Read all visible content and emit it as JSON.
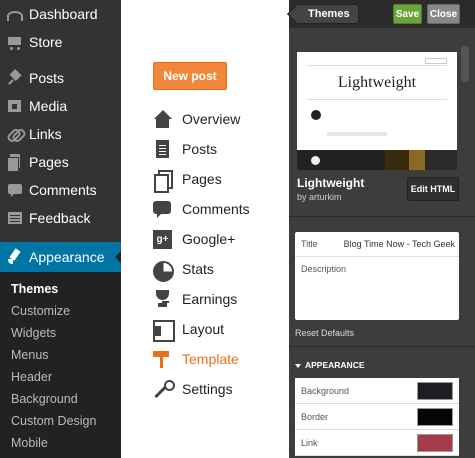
{
  "wp_menu": {
    "items": [
      {
        "label": "Dashboard",
        "icon": "dashboard-icon"
      },
      {
        "label": "Store",
        "icon": "cart-icon"
      },
      {
        "label": "Posts",
        "icon": "pin-icon"
      },
      {
        "label": "Media",
        "icon": "media-icon"
      },
      {
        "label": "Links",
        "icon": "link-icon"
      },
      {
        "label": "Pages",
        "icon": "pages-icon"
      },
      {
        "label": "Comments",
        "icon": "comment-icon"
      },
      {
        "label": "Feedback",
        "icon": "feedback-icon"
      }
    ],
    "active": {
      "label": "Appearance",
      "icon": "paintbrush-icon"
    },
    "submenu": [
      "Themes",
      "Customize",
      "Widgets",
      "Menus",
      "Header",
      "Background",
      "Custom Design",
      "Mobile"
    ],
    "colors": {
      "bg": "#333333",
      "active": "#0074a2",
      "submenu_bg": "#222222"
    }
  },
  "blogger_menu": {
    "new_post": "New post",
    "items": [
      {
        "label": "Overview",
        "icon": "home-icon"
      },
      {
        "label": "Posts",
        "icon": "document-icon"
      },
      {
        "label": "Pages",
        "icon": "pages-icon"
      },
      {
        "label": "Comments",
        "icon": "comment-icon"
      },
      {
        "label": "Google+",
        "icon": "google-plus-icon"
      },
      {
        "label": "Stats",
        "icon": "pie-chart-icon"
      },
      {
        "label": "Earnings",
        "icon": "trophy-icon"
      },
      {
        "label": "Layout",
        "icon": "layout-icon"
      },
      {
        "label": "Template",
        "icon": "paint-roller-icon"
      },
      {
        "label": "Settings",
        "icon": "wrench-icon"
      }
    ],
    "active_item": "Template",
    "colors": {
      "accent": "#e8701a",
      "button": "#f2863a"
    }
  },
  "customizer": {
    "back_label": "Themes",
    "save_label": "Save",
    "close_label": "Close",
    "preview_title": "Lightweight",
    "theme_name": "Lightweight",
    "theme_author": "by arturkim",
    "edit_html_label": "Edit HTML",
    "title_label": "Title",
    "title_value": "Blog Time Now - Tech Geek",
    "description_label": "Description",
    "reset_label": "Reset Defaults",
    "section_label": "APPEARANCE",
    "colors": [
      {
        "label": "Background",
        "value": "#1e1e22"
      },
      {
        "label": "Border",
        "value": "#050505"
      },
      {
        "label": "Link",
        "value": "#a53a4a"
      }
    ],
    "palette": {
      "bg": "#3d3d3d",
      "save": "#6aa43a",
      "close": "#888888"
    }
  }
}
